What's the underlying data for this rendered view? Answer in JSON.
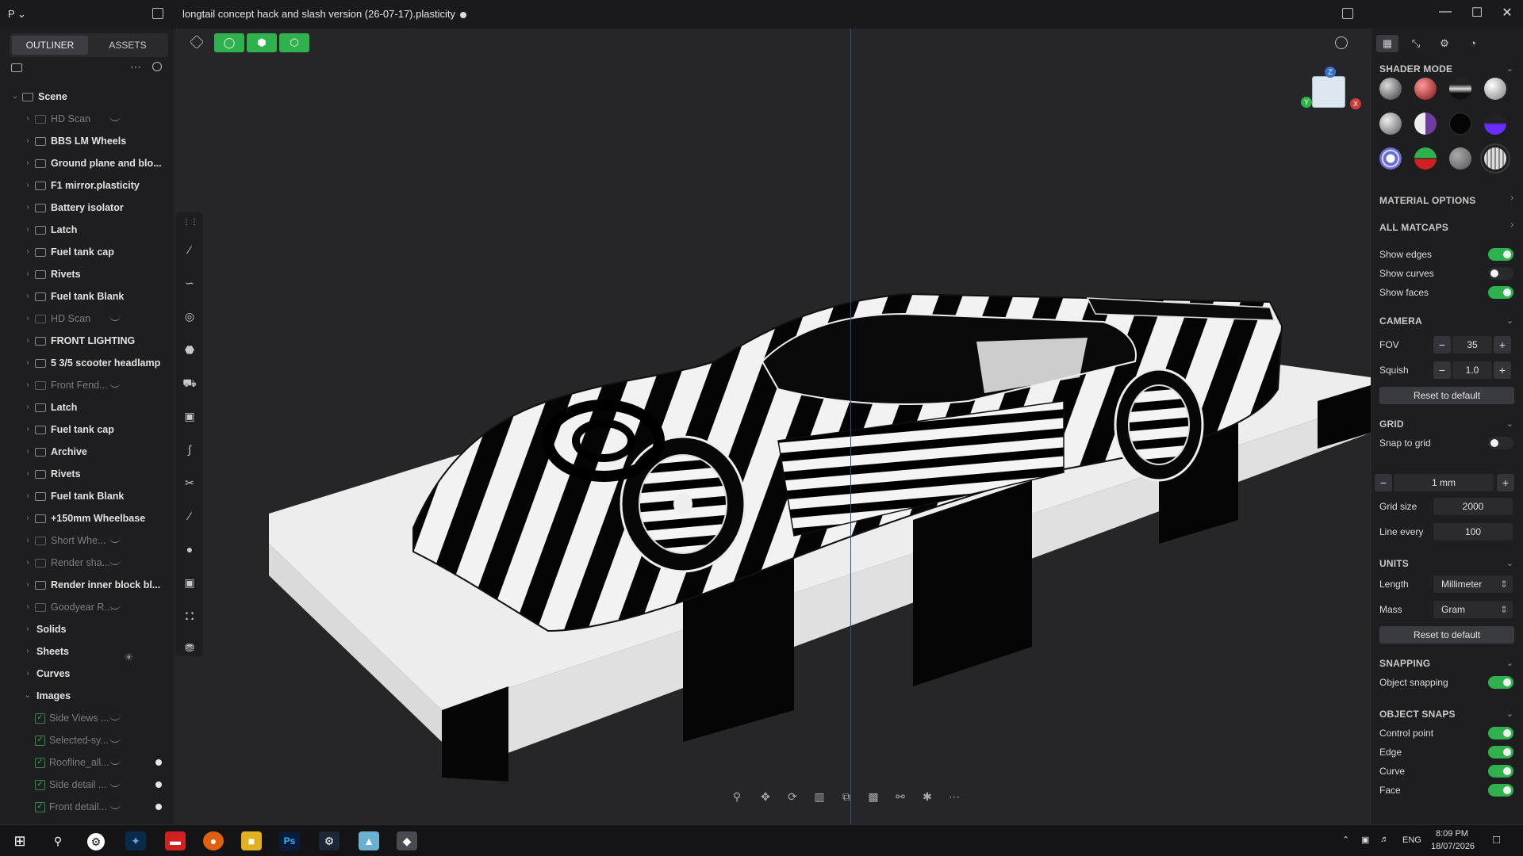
{
  "titlebar": {
    "app_menu": "P ⌄",
    "title": "longtail concept hack and slash version (26-07-17).plasticity"
  },
  "outliner": {
    "tabs": [
      "OUTLINER",
      "ASSETS"
    ],
    "active_tab": "OUTLINER",
    "items": [
      {
        "label": "Scene",
        "level": 0,
        "dim": false,
        "expanded": true
      },
      {
        "label": "HD Scan",
        "level": 1,
        "dim": true,
        "hidden": true
      },
      {
        "label": "BBS LM Wheels",
        "level": 1,
        "dim": false
      },
      {
        "label": "Ground plane and blo...",
        "level": 1,
        "dim": false
      },
      {
        "label": "F1 mirror.plasticity",
        "level": 1,
        "dim": false
      },
      {
        "label": "Battery isolator",
        "level": 1,
        "dim": false
      },
      {
        "label": "Latch",
        "level": 1,
        "dim": false
      },
      {
        "label": "Fuel tank cap",
        "level": 1,
        "dim": false
      },
      {
        "label": "Rivets",
        "level": 1,
        "dim": false
      },
      {
        "label": "Fuel tank Blank",
        "level": 1,
        "dim": false
      },
      {
        "label": "HD Scan",
        "level": 1,
        "dim": true,
        "hidden": true
      },
      {
        "label": "FRONT LIGHTING",
        "level": 1,
        "dim": false
      },
      {
        "label": "5 3/5 scooter headlamp",
        "level": 1,
        "dim": false
      },
      {
        "label": "Front Fend...",
        "level": 1,
        "dim": true,
        "hidden": true
      },
      {
        "label": "Latch",
        "level": 1,
        "dim": false
      },
      {
        "label": "Fuel tank cap",
        "level": 1,
        "dim": false
      },
      {
        "label": "Archive",
        "level": 1,
        "dim": false
      },
      {
        "label": "Rivets",
        "level": 1,
        "dim": false
      },
      {
        "label": "Fuel tank Blank",
        "level": 1,
        "dim": false
      },
      {
        "label": "+150mm Wheelbase",
        "level": 1,
        "dim": false
      },
      {
        "label": "Short Whe...",
        "level": 1,
        "dim": true,
        "hidden": true
      },
      {
        "label": "Render sha...",
        "level": 1,
        "dim": true,
        "hidden": true
      },
      {
        "label": "Render inner block bl...",
        "level": 1,
        "dim": false
      },
      {
        "label": "Goodyear R...",
        "level": 1,
        "dim": true,
        "hidden": true
      },
      {
        "label": "Solids",
        "level": 1,
        "dim": false,
        "nofolder": true
      },
      {
        "label": "Sheets",
        "level": 1,
        "dim": false,
        "nofolder": true
      },
      {
        "label": "Curves",
        "level": 1,
        "dim": false,
        "nofolder": true
      },
      {
        "label": "Images",
        "level": 1,
        "dim": false,
        "nofolder": true,
        "expanded": true
      },
      {
        "label": "Side Views ...",
        "level": 2,
        "dim": true,
        "image": true,
        "hidden": true
      },
      {
        "label": "Selected-sy...",
        "level": 2,
        "dim": true,
        "image": true,
        "hidden": true
      },
      {
        "label": "Roofline_all...",
        "level": 2,
        "dim": true,
        "image": true,
        "hidden": true,
        "dot": true
      },
      {
        "label": "Side detail ...",
        "level": 2,
        "dim": true,
        "image": true,
        "hidden": true,
        "dot": true
      },
      {
        "label": "Front detail...",
        "level": 2,
        "dim": true,
        "image": true,
        "hidden": true,
        "dot": true
      }
    ]
  },
  "rightpanel": {
    "shader_mode": "SHADER MODE",
    "material_options": "MATERIAL OPTIONS",
    "all_matcaps": "ALL MATCAPS",
    "show_edges": "Show edges",
    "show_curves": "Show curves",
    "show_faces": "Show faces",
    "camera": "CAMERA",
    "fov_label": "FOV",
    "fov_value": "35",
    "squish_label": "Squish",
    "squish_value": "1.0",
    "reset_default": "Reset to default",
    "grid": "GRID",
    "snap_to_grid": "Snap to grid",
    "grid_step": "1 mm",
    "grid_size_label": "Grid size",
    "grid_size_value": "2000",
    "line_every_label": "Line every",
    "line_every_value": "100",
    "units": "UNITS",
    "length_label": "Length",
    "length_value": "Millimeter",
    "mass_label": "Mass",
    "mass_value": "Gram",
    "reset_default2": "Reset to default",
    "snapping": "SNAPPING",
    "object_snapping": "Object snapping",
    "object_snaps": "OBJECT SNAPS",
    "snap_control_point": "Control point",
    "snap_edge": "Edge",
    "snap_curve": "Curve",
    "snap_face": "Face"
  },
  "viewcube": {
    "z": "Z",
    "y": "Y",
    "x": "X"
  },
  "taskbar": {
    "lang": "ENG",
    "time": "8:09 PM",
    "date": "18/07/2026"
  },
  "colors": {
    "accent": "#2fb24e",
    "axis_blue": "#2f4f86"
  }
}
